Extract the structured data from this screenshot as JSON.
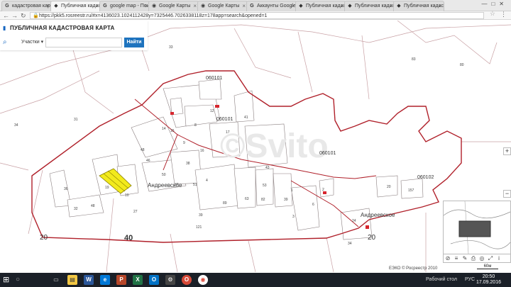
{
  "browser": {
    "tabs": [
      {
        "label": "кадастровая карта",
        "icon": "google-icon"
      },
      {
        "label": "Публичная кадаст",
        "icon": "rosreestr-icon",
        "active": true
      },
      {
        "label": "google map - Пои",
        "icon": "google-icon"
      },
      {
        "label": "Google Карты",
        "icon": "google-maps-icon"
      },
      {
        "label": "Google Карты",
        "icon": "google-maps-icon"
      },
      {
        "label": "Аккаунты Google",
        "icon": "google-icon"
      },
      {
        "label": "Публичная кадаст",
        "icon": "rosreestr-icon"
      },
      {
        "label": "Публичная кадаст",
        "icon": "rosreestr-icon"
      },
      {
        "label": "Публичная кадаст",
        "icon": "rosreestr-icon"
      }
    ],
    "url": "https://pkk5.rosreestr.ru/#x=4136023.1024112428y=7325446.7026338118z=178app=search&opened=1"
  },
  "app": {
    "title": "ПУБЛИЧНАЯ КАДАСТРОВАЯ КАРТА",
    "category_select": "Участки",
    "search_placeholder": "",
    "find_button": "Найти"
  },
  "map": {
    "quarter_labels": [
      "060101",
      "060101",
      "060101",
      "060102"
    ],
    "village_labels": [
      "Андреевское",
      "Андреевское"
    ],
    "zone_labels": [
      "20",
      "40",
      "20"
    ],
    "parcel_labels": [
      "33",
      "34",
      "31",
      "83",
      "80",
      "12",
      "14",
      "15",
      "16",
      "8",
      "9",
      "17",
      "41",
      "46",
      "43",
      "48",
      "50",
      "51",
      "53",
      "32",
      "38",
      "37",
      "39",
      "89",
      "63",
      "82",
      "2",
      "20",
      "157",
      "24",
      "34",
      "19",
      "27",
      "10",
      "36",
      "39",
      "1",
      "4",
      "3",
      "6",
      "121",
      "48"
    ],
    "watermark": "©Svito",
    "highlight_color": "#f2ea1c",
    "boundary_color": "#b0202a"
  },
  "footer": {
    "attribution": "ЕЭКО © Росреестр 2010",
    "scale": "60м"
  },
  "taskbar": {
    "tray_lang": "РУС",
    "tray_desktop": "Рабочий стол",
    "time": "20:50",
    "date": "17.09.2016"
  }
}
